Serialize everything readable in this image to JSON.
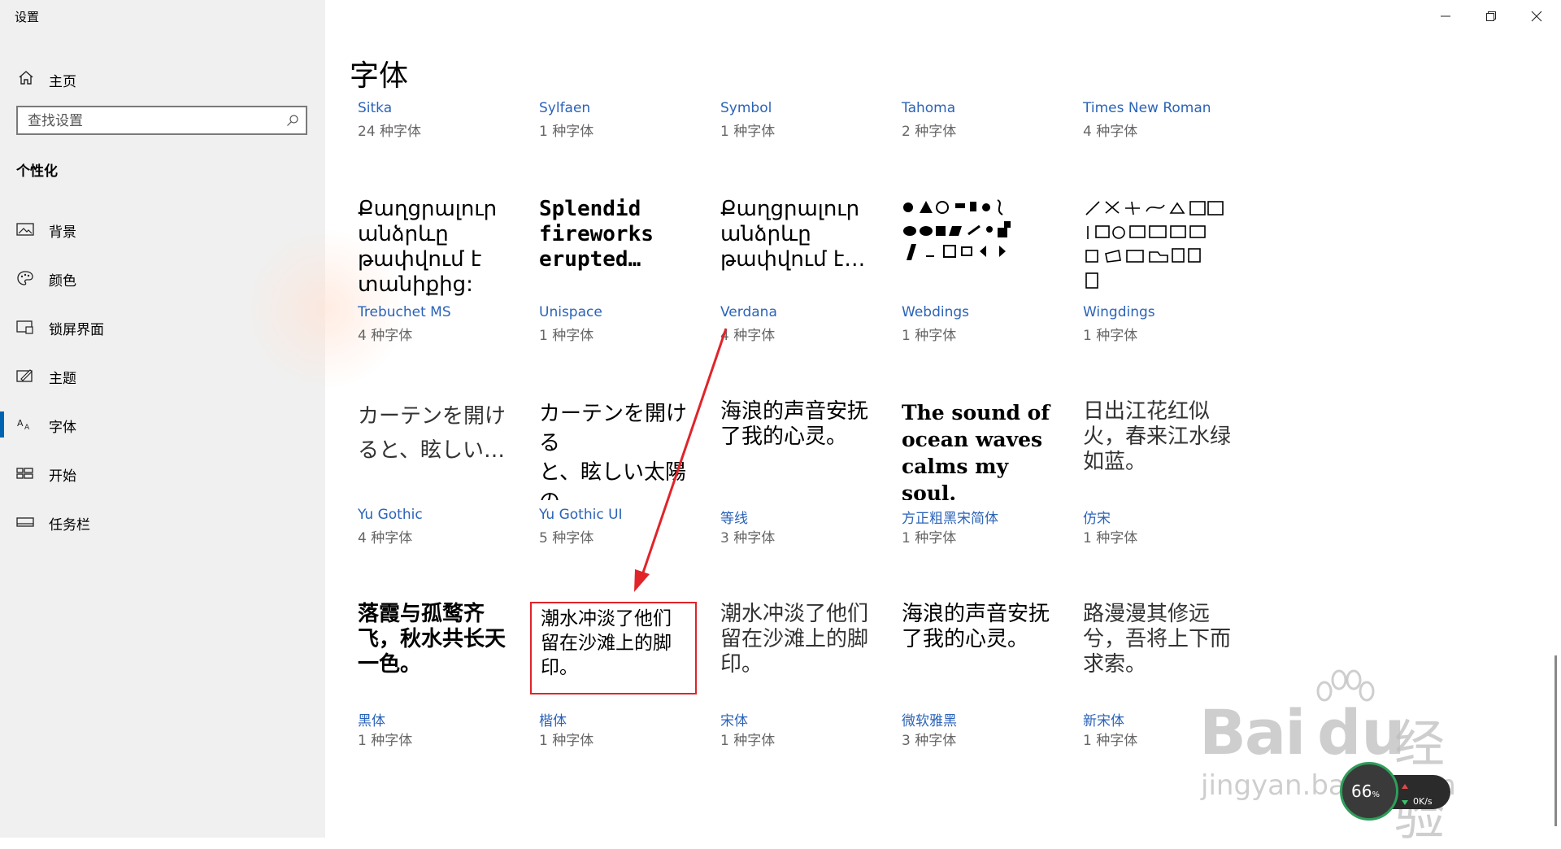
{
  "window": {
    "title": "设置"
  },
  "sidebar": {
    "home_label": "主页",
    "search_placeholder": "查找设置",
    "section_title": "个性化",
    "items": [
      {
        "label": "背景",
        "icon": "picture-icon"
      },
      {
        "label": "颜色",
        "icon": "palette-icon"
      },
      {
        "label": "锁屏界面",
        "icon": "lockscreen-icon"
      },
      {
        "label": "主题",
        "icon": "theme-icon"
      },
      {
        "label": "字体",
        "icon": "font-icon",
        "selected": true
      },
      {
        "label": "开始",
        "icon": "start-icon"
      },
      {
        "label": "任务栏",
        "icon": "taskbar-icon"
      }
    ]
  },
  "main": {
    "title": "字体",
    "fonts_row1": [
      {
        "name": "Sitka",
        "count": "24 种字体"
      },
      {
        "name": "Sylfaen",
        "count": "1 种字体"
      },
      {
        "name": "Symbol",
        "count": "1 种字体"
      },
      {
        "name": "Tahoma",
        "count": "2 种字体"
      },
      {
        "name": "Times New Roman",
        "count": "4 种字体"
      }
    ],
    "fonts_row2": [
      {
        "name": "Trebuchet MS",
        "count": "4 种字体",
        "preview": "Քաղցրալուր\nանձրևը\nթափվում է\nտանիքից:"
      },
      {
        "name": "Unispace",
        "count": "1 种字体",
        "preview": "Splendid\nfireworks\nerupted…"
      },
      {
        "name": "Verdana",
        "count": "4 种字体",
        "preview": "Քաղցրալուր\nանձրևը\nթափվում է…"
      },
      {
        "name": "Webdings",
        "count": "1 种字体",
        "preview": ""
      },
      {
        "name": "Wingdings",
        "count": "1 种字体",
        "preview": ""
      }
    ],
    "fonts_row3": [
      {
        "name": "Yu Gothic",
        "count": "4 种字体",
        "preview": "カーテンを開け\nると、眩しい…"
      },
      {
        "name": "Yu Gothic UI",
        "count": "5 种字体",
        "preview": "カーテンを開ける\nと、眩しい太陽の\n光が部屋に差…"
      },
      {
        "name": "等线",
        "count": "3 种字体",
        "preview": "海浪的声音安抚\n了我的心灵。"
      },
      {
        "name": "方正粗黑宋简体",
        "count": "1 种字体",
        "preview": "The sound of\nocean waves\ncalms my soul."
      },
      {
        "name": "仿宋",
        "count": "1 种字体",
        "preview": "日出江花红似\n火，春来江水绿\n如蓝。"
      }
    ],
    "fonts_row4": [
      {
        "name": "黑体",
        "count": "1 种字体",
        "preview": "落霞与孤鹜齐\n飞，秋水共长天\n一色。"
      },
      {
        "name": "楷体",
        "count": "1 种字体",
        "preview": "潮水冲淡了他们\n留在沙滩上的脚\n印。"
      },
      {
        "name": "宋体",
        "count": "1 种字体",
        "preview": "潮水冲淡了他们\n留在沙滩上的脚\n印。"
      },
      {
        "name": "微软雅黑",
        "count": "3 种字体",
        "preview": "海浪的声音安抚\n了我的心灵。"
      },
      {
        "name": "新宋体",
        "count": "1 种字体",
        "preview": "路漫漫其修远\n兮，吾将上下而\n求索。"
      }
    ]
  },
  "overlay": {
    "watermark_brand": "Bai",
    "watermark_brand2": "du",
    "watermark_cn": "经验",
    "watermark_url": "jingyan.baidu.com",
    "speed_percent": "66",
    "speed_percent_unit": "%",
    "speed_rate": "0K/s",
    "annotation_color": "#e0242a",
    "accent_color": "#0063b1",
    "link_color": "#2b63b8"
  }
}
